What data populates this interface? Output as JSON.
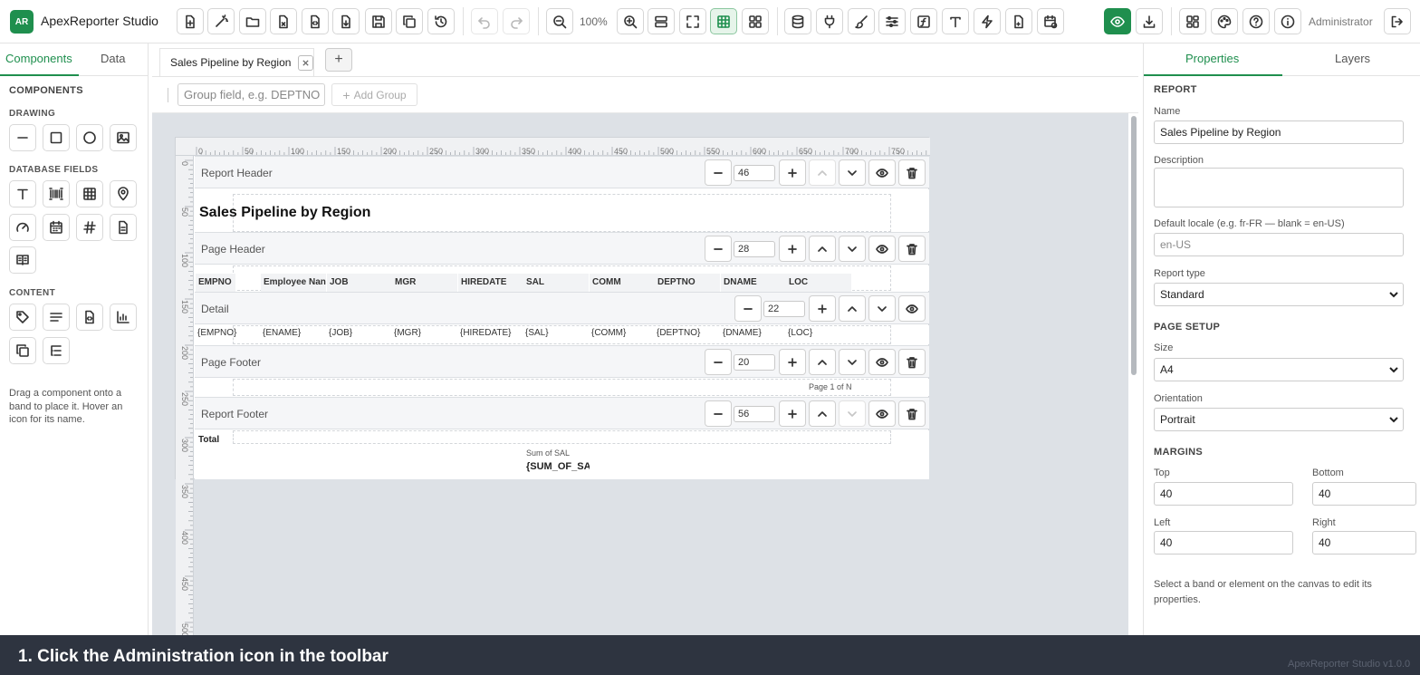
{
  "app": {
    "logo": "AR",
    "title": "ApexReporter Studio",
    "zoom": "100%",
    "user": "Administrator",
    "version": "ApexReporter Studio v1.0.0"
  },
  "colors": {
    "accent": "#1f8f4e",
    "overlay": "#2e3440",
    "canvas": "#dde1e6"
  },
  "toolbar": {
    "icons": [
      "new-report-icon",
      "magic-wand-icon",
      "open-folder-icon",
      "export-file-icon",
      "code-file-icon",
      "import-file-icon",
      "save-icon",
      "duplicate-icon",
      "history-icon",
      "undo-icon",
      "redo-icon",
      "zoom-out-icon",
      "zoom-in-icon",
      "bands-icon",
      "fullscreen-icon",
      "grid-icon",
      "layout-icon",
      "database-icon",
      "plug-icon",
      "brush-icon",
      "sliders-icon",
      "function-icon",
      "text-icon",
      "lightning-icon",
      "script-icon",
      "schedule-icon",
      "preview-icon",
      "download-icon",
      "dashboard-icon",
      "theme-icon",
      "help-icon",
      "administration-icon",
      "logout-icon"
    ]
  },
  "left_panel": {
    "tabs": [
      "Components",
      "Data"
    ],
    "heading": "COMPONENTS",
    "drawing_label": "DRAWING",
    "database_label": "DATABASE FIELDS",
    "content_label": "CONTENT",
    "drawing": [
      "line-icon",
      "rectangle-icon",
      "ellipse-icon",
      "image-icon"
    ],
    "database": [
      "text-field-icon",
      "barcode-icon",
      "table-icon",
      "location-icon",
      "gauge-icon",
      "date-field-icon",
      "number-field-icon",
      "rich-text-icon",
      "book-icon"
    ],
    "content": [
      "label-icon",
      "paragraph-icon",
      "html-icon",
      "chart-icon",
      "subreport-icon",
      "list-tree-icon"
    ],
    "hint": "Drag a component onto a band to place it. Hover an icon for its name."
  },
  "center": {
    "tab_title": "Sales Pipeline by Region",
    "group_placeholder": "Group field, e.g. DEPTNO",
    "add_group": "Add Group",
    "ruler_h": [
      "0",
      "50",
      "100",
      "150",
      "200",
      "250",
      "300",
      "350",
      "400",
      "450",
      "500",
      "550",
      "600",
      "650",
      "700",
      "750"
    ],
    "ruler_v": [
      "0",
      "50",
      "100",
      "150",
      "200",
      "250",
      "300",
      "350",
      "400",
      "450",
      "500"
    ],
    "bands": {
      "report_header": {
        "name": "Report Header",
        "height": "46"
      },
      "page_header": {
        "name": "Page Header",
        "height": "28"
      },
      "detail": {
        "name": "Detail",
        "height": "22"
      },
      "page_footer": {
        "name": "Page Footer",
        "height": "20"
      },
      "report_footer": {
        "name": "Report Footer",
        "height": "56"
      }
    },
    "report_title": "Sales Pipeline by Region",
    "columns": [
      "EMPNO",
      "Employee Nan",
      "JOB",
      "MGR",
      "HIREDATE",
      "SAL",
      "COMM",
      "DEPTNO",
      "DNAME",
      "LOC"
    ],
    "fields": [
      "{EMPNO}",
      "{ENAME}",
      "{JOB}",
      "{MGR}",
      "{HIREDATE}",
      "{SAL}",
      "{COMM}",
      "{DEPTNO}",
      "{DNAME}",
      "{LOC}"
    ],
    "page_footer_text": "Page 1 of N",
    "total_label": "Total",
    "sum_label": "Sum of SAL",
    "sum_field": "{SUM_OF_SA"
  },
  "right_panel": {
    "tabs": [
      "Properties",
      "Layers"
    ],
    "section_report": "REPORT",
    "name_label": "Name",
    "name_value": "Sales Pipeline by Region",
    "description_label": "Description",
    "locale_label": "Default locale (e.g. fr-FR — blank = en-US)",
    "locale_placeholder": "en-US",
    "type_label": "Report type",
    "type_value": "Standard",
    "section_page": "PAGE SETUP",
    "size_label": "Size",
    "size_value": "A4",
    "orientation_label": "Orientation",
    "orientation_value": "Portrait",
    "section_margins": "MARGINS",
    "top_label": "Top",
    "top_value": "40",
    "bottom_label": "Bottom",
    "bottom_value": "40",
    "left_label": "Left",
    "left_value": "40",
    "right_label": "Right",
    "right_value": "40",
    "note": "Select a band or element on the canvas to edit its properties."
  },
  "instruction": "1. Click the Administration icon in the toolbar"
}
